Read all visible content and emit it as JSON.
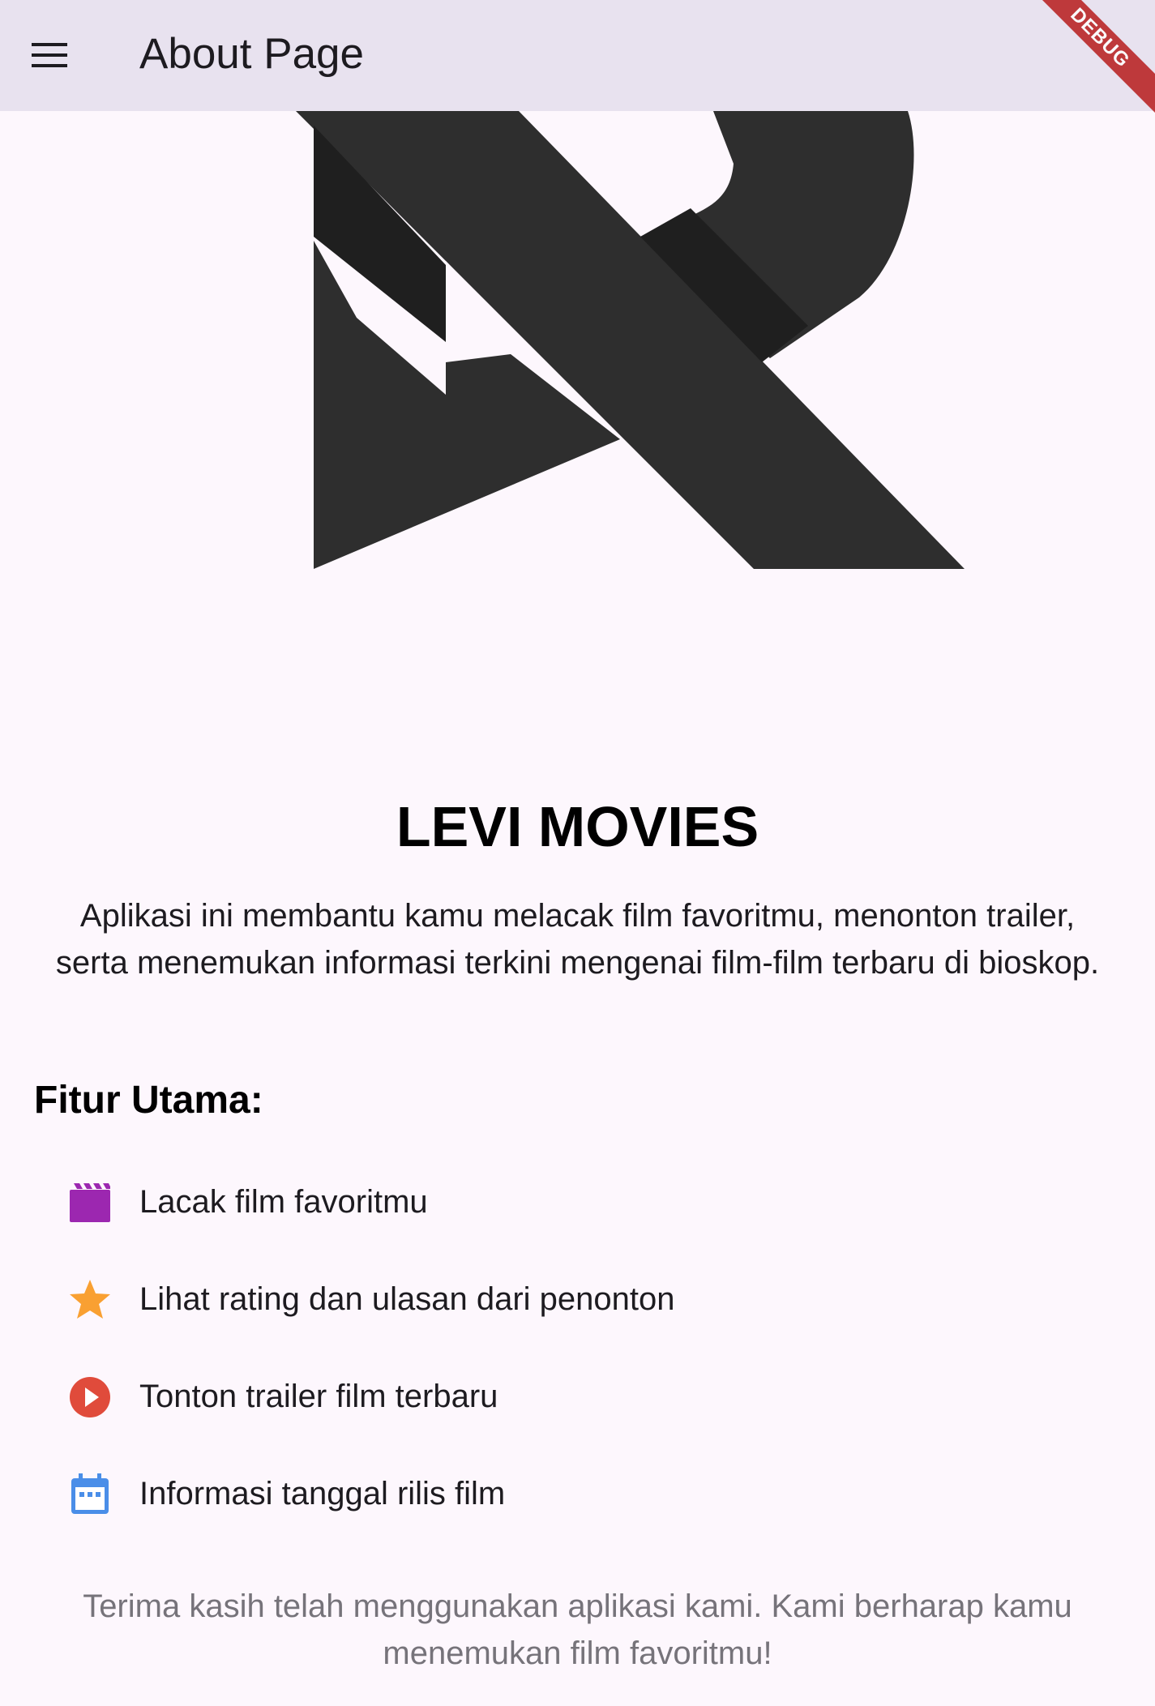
{
  "appbar": {
    "title": "About Page",
    "debug_label": "DEBUG"
  },
  "main": {
    "brand": "LEVI MOVIES",
    "description": "Aplikasi ini membantu kamu melacak film favoritmu, menonton trailer, serta menemukan informasi terkini mengenai film-film terbaru di bioskop.",
    "features_title": "Fitur Utama:",
    "features": [
      {
        "icon": "movie-clapper-icon",
        "label": "Lacak film favoritmu",
        "color": "#9c27b0"
      },
      {
        "icon": "star-icon",
        "label": "Lihat rating dan ulasan dari penonton",
        "color": "#f9a032"
      },
      {
        "icon": "play-circle-icon",
        "label": "Tonton trailer film terbaru",
        "color": "#e04b3b"
      },
      {
        "icon": "calendar-icon",
        "label": "Informasi tanggal rilis film",
        "color": "#4a8ee8"
      }
    ],
    "thanks": "Terima kasih telah menggunakan aplikasi kami. Kami berharap kamu menemukan film favoritmu!"
  },
  "colors": {
    "appbar_bg": "#e8e2ef",
    "page_bg": "#fdf7fd",
    "logo_dark": "#2e2e2e",
    "logo_shadow": "#1f1f1f"
  }
}
